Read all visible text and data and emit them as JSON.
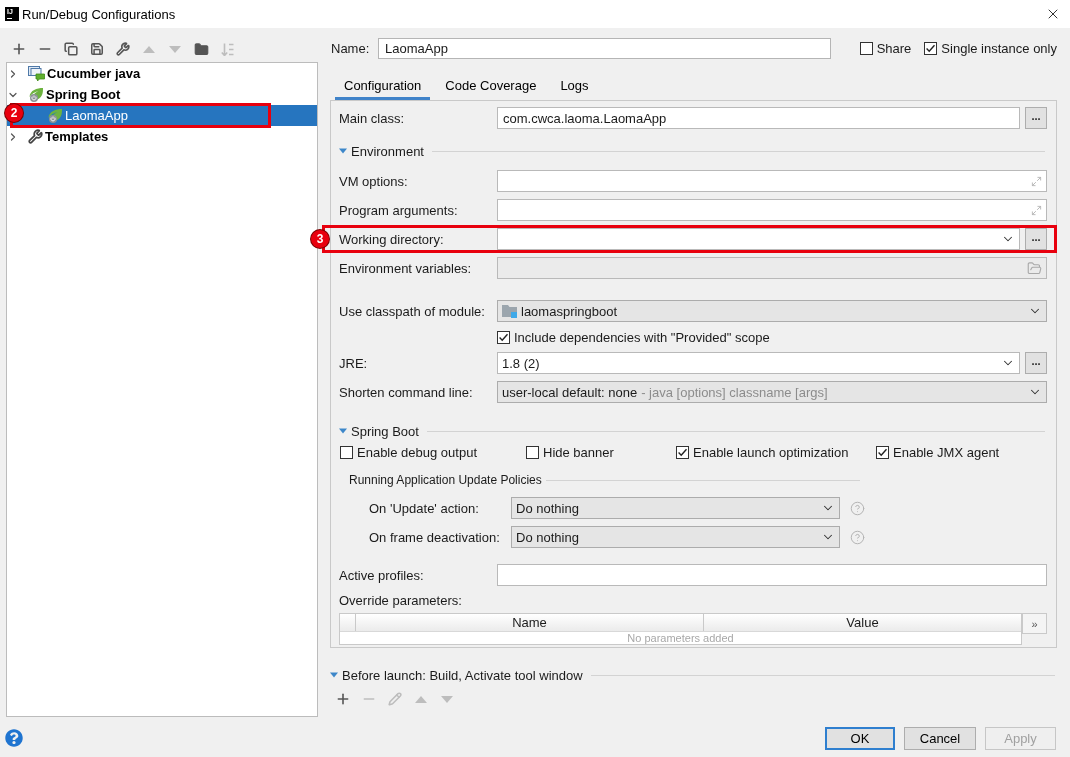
{
  "window": {
    "title": "Run/Debug Configurations",
    "logo": "IJ"
  },
  "toolbar": [
    {
      "kind": "add",
      "disabled": false
    },
    {
      "kind": "remove",
      "disabled": false
    },
    {
      "kind": "copy",
      "disabled": false
    },
    {
      "kind": "save",
      "disabled": false
    },
    {
      "kind": "wrench",
      "disabled": false
    },
    {
      "kind": "up",
      "disabled": true
    },
    {
      "kind": "down",
      "disabled": true
    },
    {
      "kind": "folder_add",
      "disabled": false
    },
    {
      "kind": "sort",
      "disabled": true
    }
  ],
  "tree": [
    {
      "label": "Cucumber java",
      "kind": "cucumber",
      "expanded": false,
      "selected": false
    },
    {
      "label": "Spring Boot",
      "kind": "spring",
      "expanded": true,
      "selected": false,
      "children": [
        {
          "label": "LaomaApp",
          "kind": "spring",
          "selected": true,
          "annotation": "2"
        }
      ]
    },
    {
      "label": "Templates",
      "kind": "templates",
      "expanded": false,
      "selected": false
    }
  ],
  "name": {
    "label": "Name:",
    "value": "LaomaApp"
  },
  "options": [
    {
      "label": "Share",
      "checked": false
    },
    {
      "label": "Single instance only",
      "checked": true
    }
  ],
  "tabs": [
    {
      "label": "Configuration",
      "selected": true
    },
    {
      "label": "Code Coverage",
      "selected": false
    },
    {
      "label": "Logs",
      "selected": false
    }
  ],
  "main_class": {
    "label": "Main class:",
    "value": "com.cwca.laoma.LaomaApp",
    "button": "..."
  },
  "environment": {
    "title": "Environment",
    "expanded": true,
    "rows": [
      {
        "kind": "expandable",
        "label": "VM options:"
      },
      {
        "kind": "expandable",
        "label": "Program arguments:"
      },
      {
        "kind": "combo",
        "label": "Working directory:",
        "editable": true,
        "button": "...",
        "annotation": "3"
      },
      {
        "kind": "folder",
        "label": "Environment variables:",
        "disabled": true
      },
      {
        "kind": "module",
        "label": "Use classpath of module:",
        "value": "laomaspringboot",
        "editable": false
      },
      {
        "kind": "checkbox",
        "label": "Include dependencies with \"Provided\" scope",
        "checked": true
      },
      {
        "kind": "combo",
        "label": "JRE:",
        "value": "1.8 (2)",
        "editable": true,
        "button": "..."
      },
      {
        "kind": "combo",
        "label": "Shorten command line:",
        "value": "user-local default: none",
        "hint": "- java [options] classname [args]",
        "editable": false
      }
    ]
  },
  "spring_boot": {
    "title": "Spring Boot",
    "expanded": true,
    "checkboxes": [
      {
        "label": "Enable debug output",
        "checked": false
      },
      {
        "label": "Hide banner",
        "checked": false
      },
      {
        "label": "Enable launch optimization",
        "checked": true
      },
      {
        "label": "Enable JMX agent",
        "checked": true
      }
    ],
    "update_policies": {
      "title": "Running Application Update Policies",
      "rows": [
        {
          "label": "On 'Update' action:",
          "value": "Do nothing"
        },
        {
          "label": "On frame deactivation:",
          "value": "Do nothing"
        }
      ]
    },
    "active_profiles": {
      "label": "Active profiles:"
    },
    "override_parameters": {
      "label": "Override parameters:",
      "columns": [
        "Name",
        "Value"
      ],
      "empty_text": "No parameters added",
      "button": "»"
    }
  },
  "before_launch": {
    "title": "Before launch: Build, Activate tool window",
    "expanded": true,
    "toolbar": [
      {
        "kind": "add",
        "disabled": false
      },
      {
        "kind": "remove",
        "disabled": true
      },
      {
        "kind": "edit",
        "disabled": true
      },
      {
        "kind": "up",
        "disabled": true
      },
      {
        "kind": "down",
        "disabled": true
      }
    ]
  },
  "buttons": [
    {
      "label": "OK",
      "default": true,
      "disabled": false
    },
    {
      "label": "Cancel",
      "default": false,
      "disabled": false
    },
    {
      "label": "Apply",
      "default": false,
      "disabled": true
    }
  ]
}
